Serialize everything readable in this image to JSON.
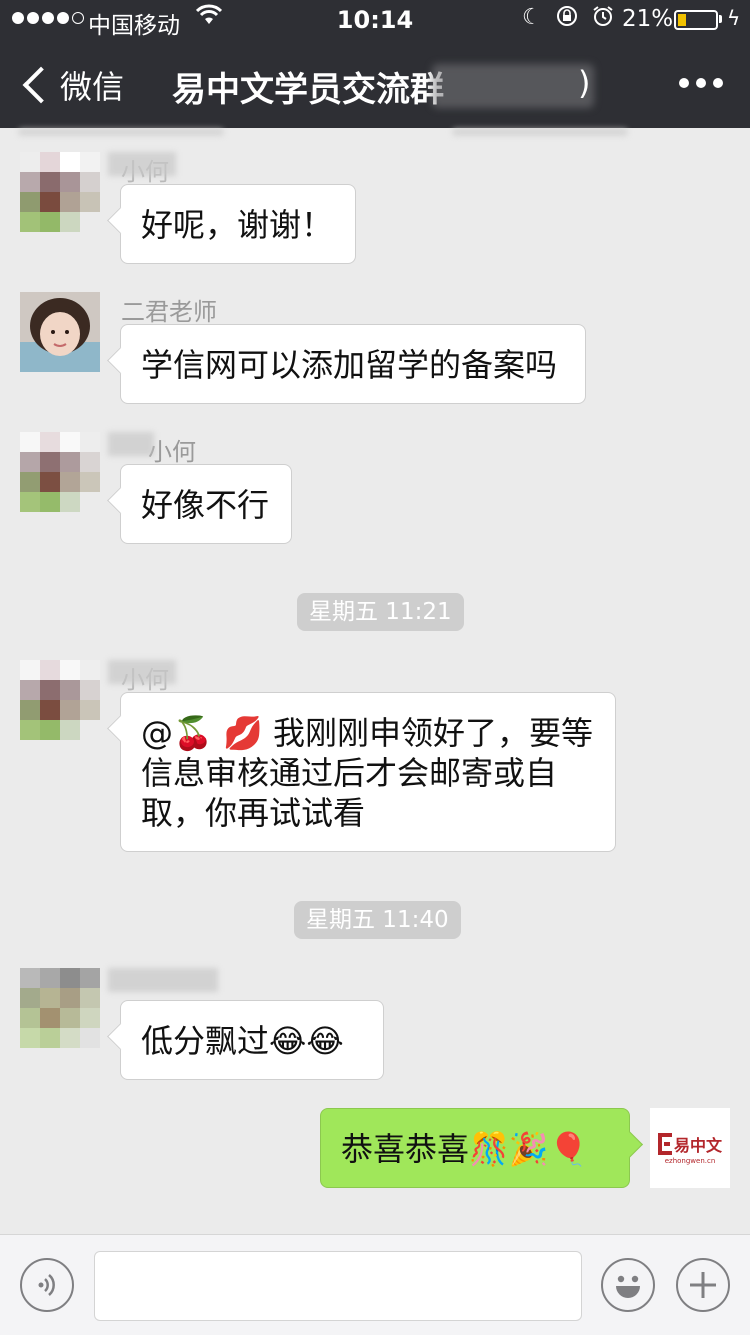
{
  "status_bar": {
    "carrier": "中国移动",
    "time": "10:14",
    "battery_percent": "21%",
    "battery_level": 0.21,
    "wifi_icon": "wifi-icon",
    "icons": [
      "moon-icon",
      "rotation-lock-icon",
      "alarm-icon"
    ]
  },
  "nav": {
    "back_label": "微信",
    "title": "易中文学员交流群",
    "title_tail": ")",
    "more_icon": "more-icon"
  },
  "messages": [
    {
      "sender": "小何",
      "text": "好呢，谢谢！"
    },
    {
      "sender": "二君老师",
      "text": "学信网可以添加留学的备案吗"
    },
    {
      "sender": "小何",
      "text": "好像不行"
    },
    {
      "time": "星期五 11:21"
    },
    {
      "sender": "小何",
      "text_lines": [
        "@🍒 💋 我刚刚申领好了，要等",
        "信息审核通过后才会邮寄或自",
        "取，你再试试看"
      ]
    },
    {
      "time": "星期五 11:40"
    },
    {
      "sender": "",
      "text": "低分飘过😂😂"
    },
    {
      "self": true,
      "text": "恭喜恭喜🎊🎉🎈"
    }
  ],
  "self_avatar": {
    "logo_text": "易中文",
    "logo_sub": "ezhongwen.cn"
  },
  "input_bar": {
    "voice_icon": "voice-icon",
    "emoji_icon": "emoji-icon",
    "plus_icon": "plus-icon",
    "value": ""
  },
  "colors": {
    "nav_bg": "#2e2f34",
    "chat_bg": "#ebebeb",
    "self_bubble": "#a0e75a",
    "battery_fill": "#f2c200",
    "logo_red": "#b3262b"
  }
}
